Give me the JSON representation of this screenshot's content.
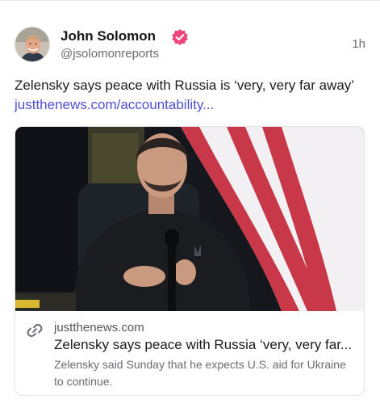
{
  "post": {
    "author_name": "John Solomon",
    "handle": "@jsolomonreports",
    "time": "1h",
    "text": "Zelensky says peace with Russia is ‘very, very far away’",
    "link_text": "justthenews.com/accountability..."
  },
  "link_card": {
    "domain": "justthenews.com",
    "title": "Zelensky says peace with Russia ‘very, very far...",
    "description": "Zelensky said Sunday that he expects U.S. aid for Ukraine to continue."
  },
  "icons": {
    "verified": "verified-badge-icon",
    "link": "link-icon"
  },
  "colors": {
    "link": "#4f4fd8",
    "verified_badge": "#f0457a",
    "muted_text": "#6b6b73"
  }
}
